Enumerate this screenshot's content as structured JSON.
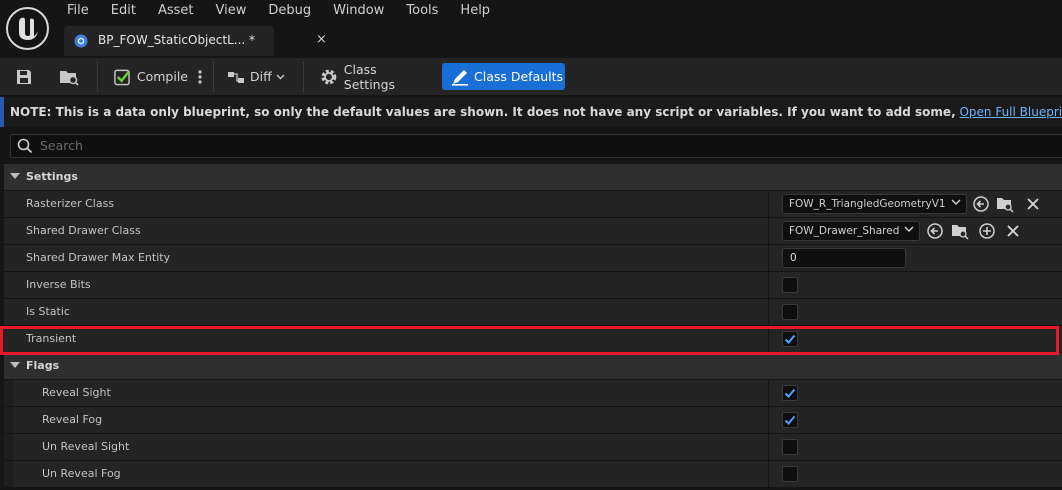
{
  "menu": [
    "File",
    "Edit",
    "Asset",
    "View",
    "Debug",
    "Window",
    "Tools",
    "Help"
  ],
  "tab": {
    "title": "BP_FOW_StaticObjectL...",
    "modified": "*",
    "close": "×"
  },
  "toolbar": {
    "compile_label": "Compile",
    "diff_label": "Diff",
    "class_settings_label": "Class Settings",
    "class_defaults_label": "Class Defaults"
  },
  "note": {
    "text": "NOTE: This is a data only blueprint, so only the default values are shown.  It does not have any script or variables.  If you want to add some,",
    "link": "Open Full Blueprint Editor"
  },
  "search": {
    "placeholder": "Search"
  },
  "categories": {
    "settings": "Settings",
    "flags": "Flags"
  },
  "properties": {
    "rasterizer_class": {
      "label": "Rasterizer Class",
      "value": "FOW_R_TriangledGeometryV1"
    },
    "shared_drawer_class": {
      "label": "Shared Drawer Class",
      "value": "FOW_Drawer_Shared"
    },
    "shared_drawer_max_entity": {
      "label": "Shared Drawer Max Entity",
      "value": "0"
    },
    "inverse_bits": {
      "label": "Inverse Bits",
      "checked": false
    },
    "is_static": {
      "label": "Is Static",
      "checked": false
    },
    "transient": {
      "label": "Transient",
      "checked": true
    }
  },
  "flags": {
    "reveal_sight": {
      "label": "Reveal Sight",
      "checked": true
    },
    "reveal_fog": {
      "label": "Reveal Fog",
      "checked": true
    },
    "un_reveal_sight": {
      "label": "Un Reveal Sight",
      "checked": false
    },
    "un_reveal_fog": {
      "label": "Un Reveal Fog",
      "checked": false
    }
  },
  "colors": {
    "accent": "#1a6fd6",
    "highlight": "#e8192c",
    "check": "#4aa3ff"
  }
}
